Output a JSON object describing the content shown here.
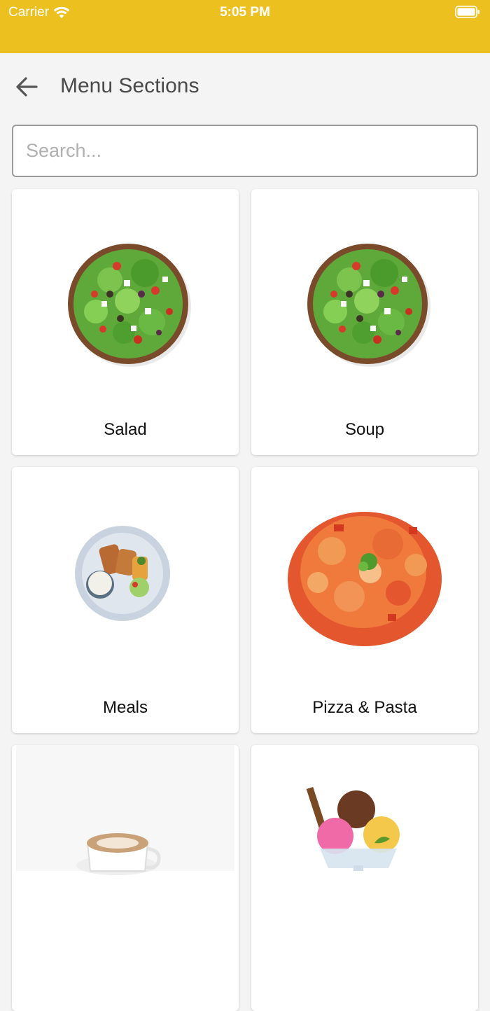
{
  "status_bar": {
    "carrier": "Carrier",
    "time": "5:05 PM",
    "background_color": "#ecc01e",
    "icons": [
      "wifi-icon",
      "battery-icon"
    ]
  },
  "header": {
    "title": "Menu Sections",
    "back_icon": "arrow-left-icon"
  },
  "search": {
    "placeholder": "Search..."
  },
  "sections": [
    {
      "label": "Salad",
      "image": "salad-bowl"
    },
    {
      "label": "Soup",
      "image": "salad-bowl"
    },
    {
      "label": "Meals",
      "image": "meal-plate"
    },
    {
      "label": "Pizza & Pasta",
      "image": "pasta"
    },
    {
      "label": "",
      "image": "coffee-cup"
    },
    {
      "label": "",
      "image": "ice-cream"
    }
  ]
}
